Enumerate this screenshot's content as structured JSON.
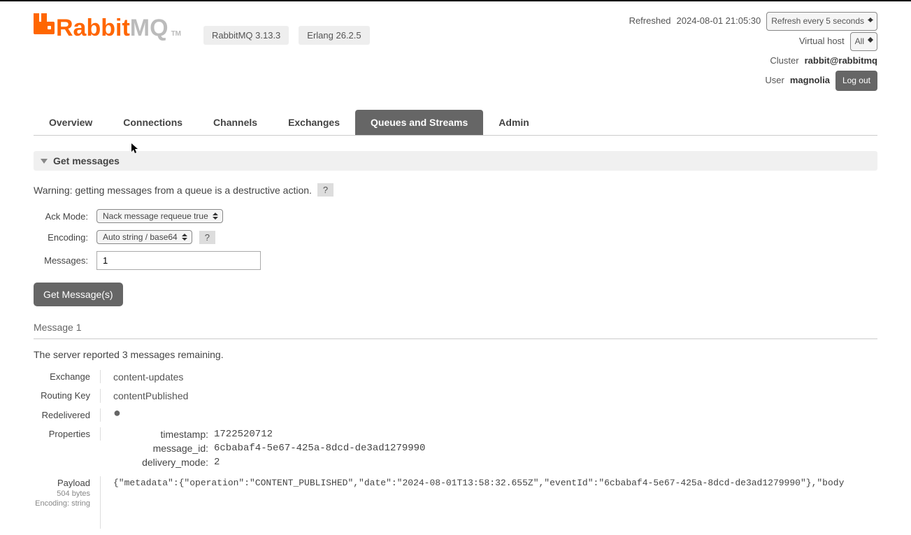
{
  "header": {
    "brand_rabbit": "Rabbit",
    "brand_mq": "MQ",
    "brand_tm": "TM",
    "version_rabbitmq": "RabbitMQ 3.13.3",
    "version_erlang": "Erlang 26.2.5"
  },
  "meta": {
    "refreshed_label": "Refreshed",
    "refreshed_time": "2024-08-01 21:05:30",
    "refresh_select": "Refresh every 5 seconds",
    "vhost_label": "Virtual host",
    "vhost_select": "All",
    "cluster_label": "Cluster",
    "cluster_value": "rabbit@rabbitmq",
    "user_label": "User",
    "user_value": "magnolia",
    "logout": "Log out"
  },
  "tabs": {
    "overview": "Overview",
    "connections": "Connections",
    "channels": "Channels",
    "exchanges": "Exchanges",
    "queues": "Queues and Streams",
    "admin": "Admin"
  },
  "section": {
    "title": "Get messages"
  },
  "warning": {
    "text": "Warning: getting messages from a queue is a destructive action.",
    "help": "?"
  },
  "form": {
    "ack_label": "Ack Mode:",
    "ack_value": "Nack message requeue true",
    "enc_label": "Encoding:",
    "enc_value": "Auto string / base64",
    "enc_help": "?",
    "msg_label": "Messages:",
    "msg_value": "1",
    "submit": "Get Message(s)"
  },
  "result": {
    "msg_header": "Message 1",
    "remaining_pre": "The server reported ",
    "remaining_count": "3",
    "remaining_post": " messages remaining.",
    "exchange_label": "Exchange",
    "exchange_value": "content-updates",
    "routing_label": "Routing Key",
    "routing_value": "contentPublished",
    "redelivered_label": "Redelivered",
    "redelivered_value": "●",
    "props_label": "Properties",
    "props": {
      "timestamp_k": "timestamp:",
      "timestamp_v": "1722520712",
      "message_id_k": "message_id:",
      "message_id_v": "6cbabaf4-5e67-425a-8dcd-de3ad1279990",
      "delivery_mode_k": "delivery_mode:",
      "delivery_mode_v": "2"
    },
    "payload_label": "Payload",
    "payload_bytes": "504 bytes",
    "payload_enc": "Encoding: string",
    "payload_text": "{\"metadata\":{\"operation\":\"CONTENT_PUBLISHED\",\"date\":\"2024-08-01T13:58:32.655Z\",\"eventId\":\"6cbabaf4-5e67-425a-8dcd-de3ad1279990\"},\"body"
  }
}
